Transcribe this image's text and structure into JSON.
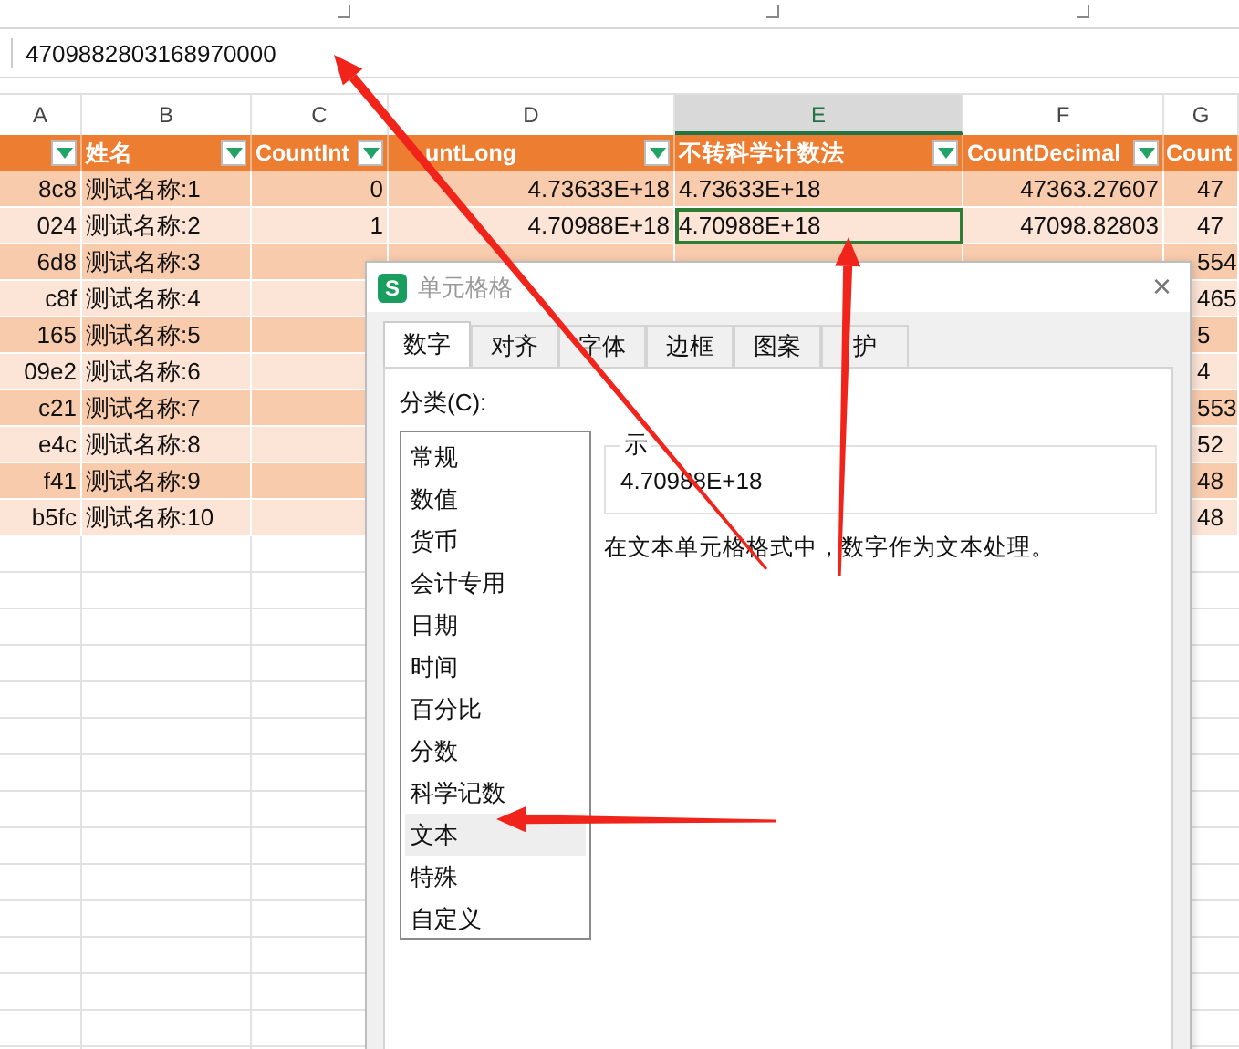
{
  "formula_bar": {
    "value": "4709882803168970000"
  },
  "sheet": {
    "columns": [
      {
        "letter": "A",
        "selected": false
      },
      {
        "letter": "B",
        "selected": false
      },
      {
        "letter": "C",
        "selected": false
      },
      {
        "letter": "D",
        "selected": false
      },
      {
        "letter": "E",
        "selected": true
      },
      {
        "letter": "F",
        "selected": false
      },
      {
        "letter": "G",
        "selected": false
      }
    ],
    "header": [
      {
        "filter": true
      },
      {
        "text": "姓名",
        "filter": true
      },
      {
        "text": "CountInt",
        "filter": true
      },
      {
        "text": "untLong",
        "filter": true
      },
      {
        "text": "不转科学计数法",
        "filter": true
      },
      {
        "text": "CountDecimal",
        "filter": true
      },
      {
        "text": "Count",
        "filter": false
      }
    ],
    "rows": [
      {
        "selected": false,
        "A": "8c8",
        "B": "测试名称:1",
        "C": "0",
        "D": "4.73633E+18",
        "E": "4.73633E+18",
        "F": "47363.27607",
        "G": "47"
      },
      {
        "selected": true,
        "A": "024",
        "B": "测试名称:2",
        "C": "1",
        "D": "4.70988E+18",
        "E": "4.70988E+18",
        "F": "47098.82803",
        "G": "47"
      },
      {
        "selected": false,
        "A": "6d8",
        "B": "测试名称:3",
        "G": "554"
      },
      {
        "selected": false,
        "A": "c8f",
        "B": "测试名称:4",
        "G": "465"
      },
      {
        "selected": false,
        "A": "165",
        "B": "测试名称:5",
        "G": "5"
      },
      {
        "selected": false,
        "A": "09e2",
        "B": "测试名称:6",
        "G": "4"
      },
      {
        "selected": false,
        "A": "c21",
        "B": "测试名称:7",
        "G": "553"
      },
      {
        "selected": false,
        "A": "e4c",
        "B": "测试名称:8",
        "G": "52"
      },
      {
        "selected": false,
        "A": "f41",
        "B": "测试名称:9",
        "G": "48"
      },
      {
        "selected": false,
        "A": "b5fc",
        "B": "测试名称:10",
        "G": "48"
      }
    ]
  },
  "dialog": {
    "app_icon": "S",
    "title": "单元格格",
    "close": "×",
    "tabs": [
      {
        "label": "数字",
        "selected": true
      },
      {
        "label": "对齐",
        "selected": false
      },
      {
        "label": "字体",
        "selected": false
      },
      {
        "label": "边框",
        "selected": false
      },
      {
        "label": "图案",
        "selected": false
      },
      {
        "label": "护",
        "selected": false
      }
    ],
    "category_label": "分类(C):",
    "categories": [
      {
        "label": "常规",
        "selected": false
      },
      {
        "label": "数值",
        "selected": false
      },
      {
        "label": "货币",
        "selected": false
      },
      {
        "label": "会计专用",
        "selected": false
      },
      {
        "label": "日期",
        "selected": false
      },
      {
        "label": "时间",
        "selected": false
      },
      {
        "label": "百分比",
        "selected": false
      },
      {
        "label": "分数",
        "selected": false
      },
      {
        "label": "科学记数",
        "selected": false
      },
      {
        "label": "文本",
        "selected": true
      },
      {
        "label": "特殊",
        "selected": false
      },
      {
        "label": "自定义",
        "selected": false
      }
    ],
    "sample": {
      "legend": "示",
      "value": "4.70988E+18"
    },
    "description": "在文本单元格格式中，数字作为文本处理。"
  }
}
